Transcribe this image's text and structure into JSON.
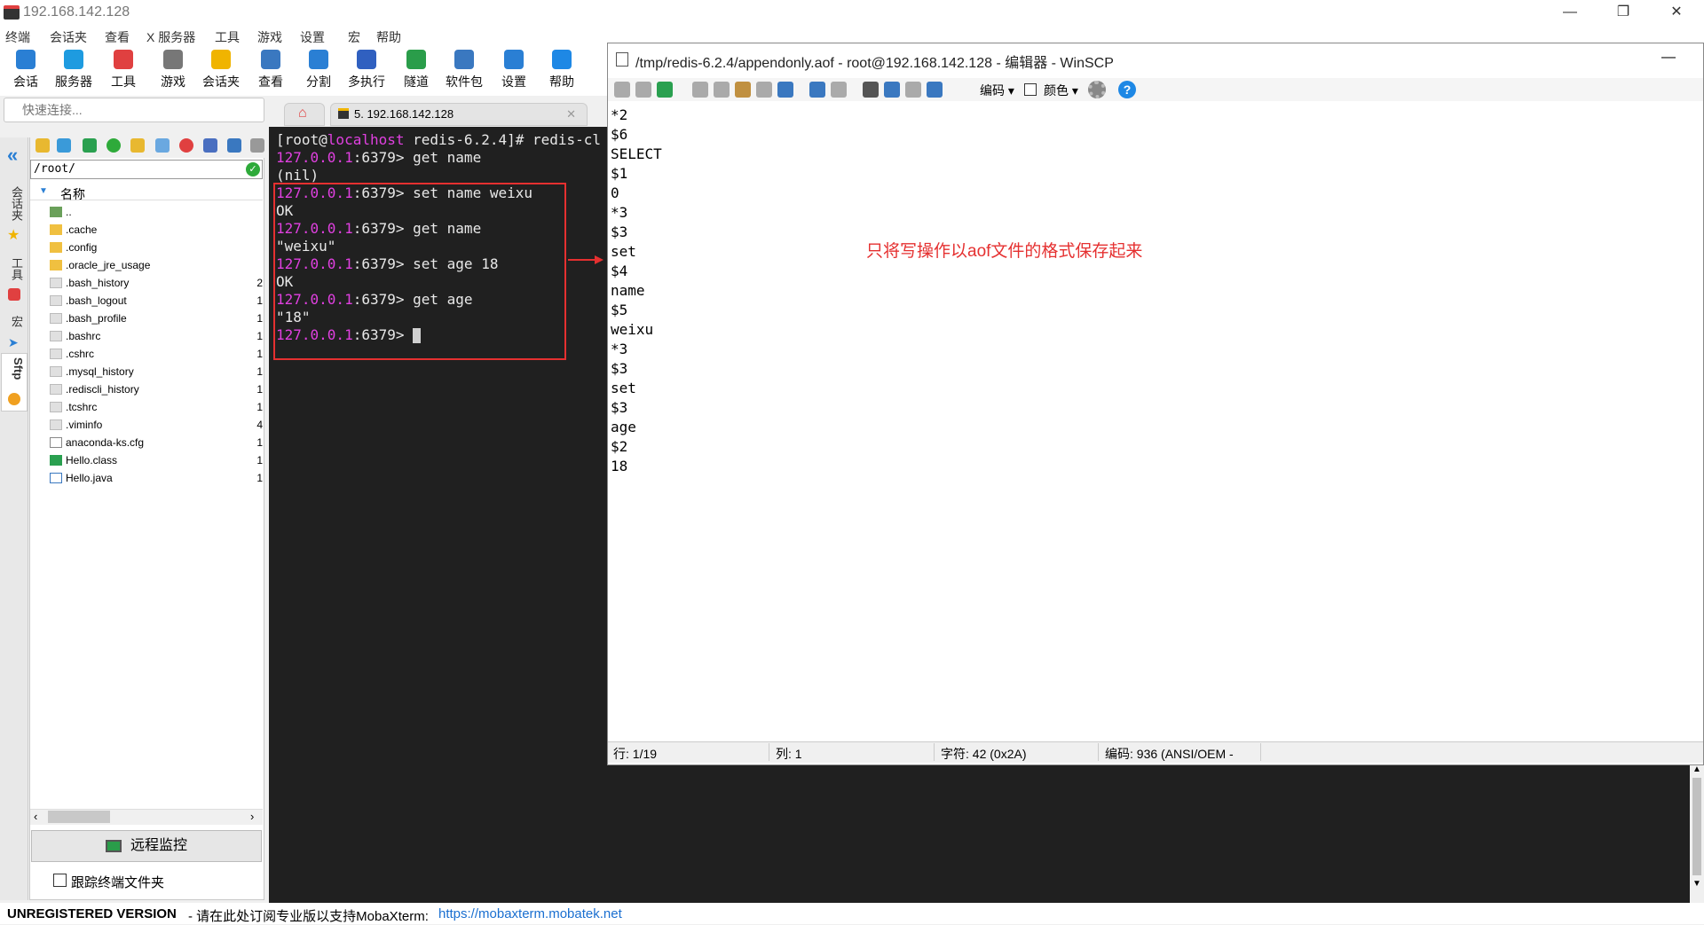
{
  "window": {
    "title": "192.168.142.128"
  },
  "menu": [
    "终端",
    "会话夹",
    "查看",
    "X 服务器",
    "工具",
    "游戏",
    "设置",
    "宏",
    "帮助"
  ],
  "toolbar": [
    {
      "label": "会话",
      "icon": "session-icon",
      "color": "#2a7fd4"
    },
    {
      "label": "服务器",
      "icon": "servers-icon",
      "color": "#1e9be0"
    },
    {
      "label": "工具",
      "icon": "tools-icon",
      "color": "#e04040"
    },
    {
      "label": "游戏",
      "icon": "games-icon",
      "color": "#777777"
    },
    {
      "label": "会话夹",
      "icon": "star-icon",
      "color": "#f0b400"
    },
    {
      "label": "查看",
      "icon": "view-icon",
      "color": "#3a78c0"
    },
    {
      "label": "分割",
      "icon": "split-icon",
      "color": "#2a7fd4"
    },
    {
      "label": "多执行",
      "icon": "multiexec-icon",
      "color": "#3060c0"
    },
    {
      "label": "隧道",
      "icon": "tunnel-icon",
      "color": "#2a9d4a"
    },
    {
      "label": "软件包",
      "icon": "packages-icon",
      "color": "#3a78c0"
    },
    {
      "label": "设置",
      "icon": "settings-icon",
      "color": "#2a7fd4"
    },
    {
      "label": "帮助",
      "icon": "help-icon",
      "color": "#1e88e5"
    }
  ],
  "quick_connect": {
    "placeholder": "快速连接..."
  },
  "side_tabs": [
    "会话夹",
    "工具",
    "宏",
    "Sftp"
  ],
  "sftp": {
    "path": "/root/",
    "column": "名称",
    "files": [
      {
        "name": "..",
        "size": "",
        "type": "parent"
      },
      {
        "name": ".cache",
        "size": "",
        "type": "folder"
      },
      {
        "name": ".config",
        "size": "",
        "type": "folder"
      },
      {
        "name": ".oracle_jre_usage",
        "size": "",
        "type": "folder"
      },
      {
        "name": ".bash_history",
        "size": "2",
        "type": "file"
      },
      {
        "name": ".bash_logout",
        "size": "1",
        "type": "file"
      },
      {
        "name": ".bash_profile",
        "size": "1",
        "type": "file"
      },
      {
        "name": ".bashrc",
        "size": "1",
        "type": "file"
      },
      {
        "name": ".cshrc",
        "size": "1",
        "type": "file"
      },
      {
        "name": ".mysql_history",
        "size": "1",
        "type": "file"
      },
      {
        "name": ".rediscli_history",
        "size": "1",
        "type": "file"
      },
      {
        "name": ".tcshrc",
        "size": "1",
        "type": "file"
      },
      {
        "name": ".viminfo",
        "size": "4",
        "type": "file"
      },
      {
        "name": "anaconda-ks.cfg",
        "size": "1",
        "type": "cfg"
      },
      {
        "name": "Hello.class",
        "size": "1",
        "type": "class"
      },
      {
        "name": "Hello.java",
        "size": "1",
        "type": "java"
      }
    ],
    "remote_monitor": "远程监控",
    "follow_terminal": "跟踪终端文件夹"
  },
  "terminal": {
    "tab": "5. 192.168.142.128",
    "lines": [
      {
        "host": "",
        "text": "[root@localhost redis-6.2.4]# redis-cl"
      },
      {
        "host": "127.0.0.1",
        "text": ":6379> get name"
      },
      {
        "host": "",
        "text": "(nil)"
      },
      {
        "host": "127.0.0.1",
        "text": ":6379> set name weixu"
      },
      {
        "host": "",
        "text": "OK"
      },
      {
        "host": "127.0.0.1",
        "text": ":6379> get name"
      },
      {
        "host": "",
        "text": "\"weixu\""
      },
      {
        "host": "127.0.0.1",
        "text": ":6379> set age 18"
      },
      {
        "host": "",
        "text": "OK"
      },
      {
        "host": "127.0.0.1",
        "text": ":6379> get age"
      },
      {
        "host": "",
        "text": "\"18\""
      },
      {
        "host": "127.0.0.1",
        "text": ":6379> "
      }
    ]
  },
  "annotation": "只将写操作以aof文件的格式保存起来",
  "editor": {
    "title": "/tmp/redis-6.2.4/appendonly.aof - root@192.168.142.128 - 编辑器 - WinSCP",
    "encoding_btn": "编码",
    "color_btn": "颜色",
    "lines": [
      "*2",
      "$6",
      "SELECT",
      "$1",
      "0",
      "*3",
      "$3",
      "set",
      "$4",
      "name",
      "$5",
      "weixu",
      "*3",
      "$3",
      "set",
      "$3",
      "age",
      "$2",
      "18"
    ],
    "status": {
      "line": "行: 1/19",
      "col": "列: 1",
      "char": "字符: 42 (0x2A)",
      "enc": "编码: 936  (ANSI/OEM -"
    }
  },
  "footer": {
    "unregistered": "UNREGISTERED VERSION",
    "promo": " -  请在此处订阅专业版以支持MobaXterm:",
    "link": "https://mobaxterm.mobatek.net"
  }
}
